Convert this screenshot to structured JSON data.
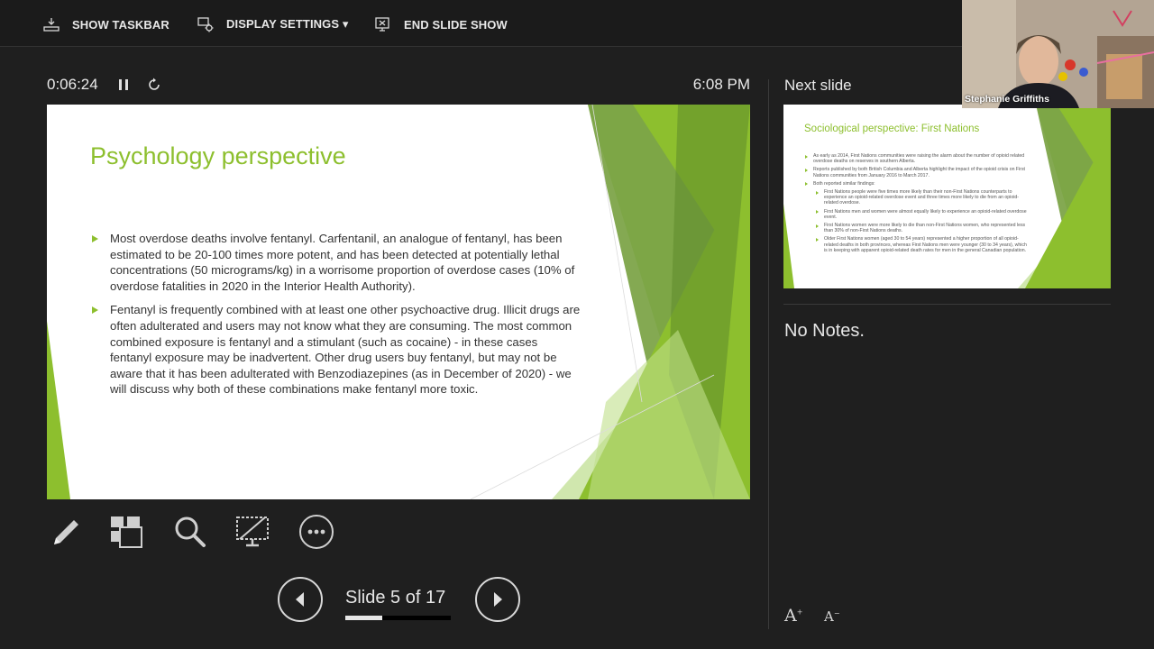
{
  "topbar": {
    "show_taskbar": "SHOW TASKBAR",
    "display_settings": "DISPLAY SETTINGS ▾",
    "end_slide_show": "END SLIDE SHOW"
  },
  "presenter": {
    "elapsed_time": "0:06:24",
    "clock": "6:08 PM"
  },
  "current_slide": {
    "title": "Psychology perspective",
    "bullets": [
      "Most overdose deaths involve fentanyl. Carfentanil, an analogue of fentanyl, has been estimated to be 20-100 times more potent, and has been detected at potentially lethal concentrations (50 micrograms/kg) in a worrisome proportion of overdose cases (10% of overdose fatalities in 2020 in the Interior Health Authority).",
      "Fentanyl is frequently combined with at least one other psychoactive drug. Illicit drugs are often adulterated and users may not know what they are consuming. The most common combined exposure is fentanyl and a stimulant (such as cocaine) - in these cases fentanyl exposure may be inadvertent. Other drug users buy fentanyl, but may not be aware that it has been adulterated with Benzodiazepines (as in December of 2020) - we will discuss why both of these combinations make fentanyl more toxic."
    ],
    "accent_color": "#8dbf2e"
  },
  "navigation": {
    "slide_counter": "Slide 5 of 17",
    "current": 5,
    "total": 17,
    "progress_fraction": 0.35
  },
  "next_slide": {
    "label": "Next slide",
    "title": "Sociological perspective: First Nations",
    "bullets": [
      "As early as 2014, First Nations communities were raising the alarm about the number of opioid related overdose deaths on reserves in southern Alberta.",
      "Reports published by both British Columbia and Alberta highlight the impact of the opioid crisis on First Nations communities from January 2016 to March 2017.",
      "Both reported similar findings:"
    ],
    "sub_bullets": [
      "First Nations people were five times more likely than their non-First Nations counterparts to experience an opioid-related overdose event and three times more likely to die from an opioid-related overdose.",
      "First Nations men and women were almost equally likely to experience an opioid-related overdose event.",
      "First Nations women were more likely to die than non-First Nations women, who represented less than 30% of non-First Nations deaths.",
      "Older First Nations women (aged 30 to 54 years) represented a higher proportion of all opioid-related deaths in both provinces, whereas First Nations men were younger (30 to 34 years), which is in keeping with apparent opioid-related death rates for men in the general Canadian population."
    ]
  },
  "notes": {
    "text": "No Notes."
  },
  "font_controls": {
    "increase": "A",
    "decrease": "A"
  },
  "webcam": {
    "name": "Stephanie Griffiths"
  },
  "icons": [
    "taskbar-icon",
    "display-settings-icon",
    "end-show-icon",
    "pause-icon",
    "restart-icon",
    "pen-icon",
    "slide-grid-icon",
    "zoom-icon",
    "black-screen-icon",
    "more-options-icon",
    "previous-arrow-icon",
    "next-arrow-icon"
  ]
}
